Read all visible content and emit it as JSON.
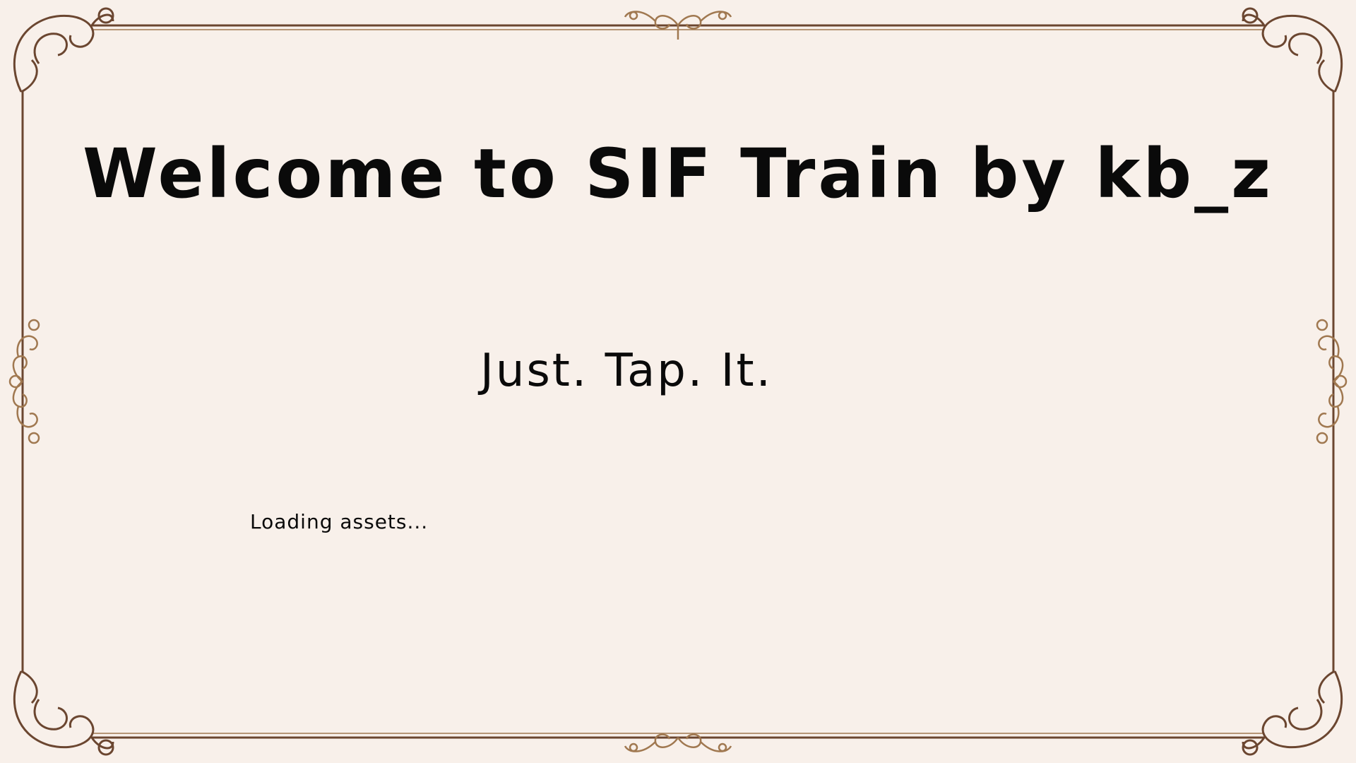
{
  "screen": {
    "title": "Welcome to SIF Train by kb_z",
    "subtitle": "Just. Tap. It.",
    "status": "Loading assets..."
  },
  "theme": {
    "background": "#f8f0ea",
    "frame_color": "#6b4630",
    "frame_ornament_color": "#a07850",
    "text_color": "#0a0a0a"
  },
  "icons": {
    "corner_ornament": "scroll-flourish",
    "edge_ornament": "fleur-flourish"
  }
}
